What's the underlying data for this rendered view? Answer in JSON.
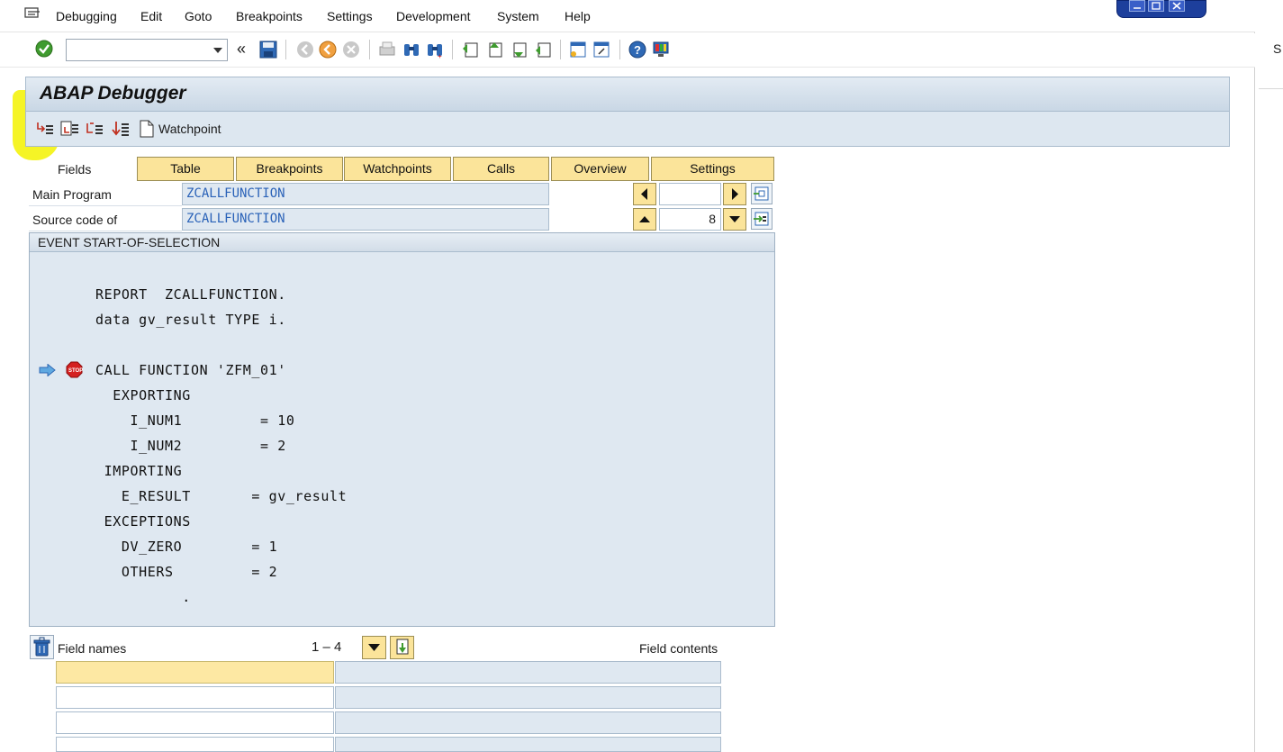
{
  "menu": {
    "items": [
      "Debugging",
      "Edit",
      "Goto",
      "Breakpoints",
      "Settings",
      "Development",
      "System",
      "Help"
    ]
  },
  "toolbar": {
    "command_value": "",
    "back_label": "«",
    "icons": [
      "check-icon",
      "save-icon",
      "back-icon",
      "exit-icon",
      "cancel-icon",
      "print-icon",
      "find-icon",
      "find-next-icon",
      "first-page-icon",
      "previous-page-icon",
      "next-page-icon",
      "last-page-icon",
      "new-session-icon",
      "shortcut-icon",
      "help-icon",
      "customize-layout-icon"
    ]
  },
  "debugger": {
    "title": "ABAP Debugger",
    "app_toolbar": {
      "watchpoint_label": "Watchpoint"
    },
    "tabs": {
      "fields_label": "Fields",
      "items": [
        "Table",
        "Breakpoints",
        "Watchpoints",
        "Calls",
        "Overview",
        "Settings"
      ]
    },
    "main_program": {
      "label": "Main Program",
      "value": "ZCALLFUNCTION",
      "nav_value": ""
    },
    "source_code": {
      "label": "Source code of",
      "value": "ZCALLFUNCTION",
      "line_value": "8"
    },
    "code": {
      "header": "EVENT START-OF-SELECTION",
      "lines": [
        "REPORT  ZCALLFUNCTION.",
        "data gv_result TYPE i.",
        "",
        "CALL FUNCTION 'ZFM_01'",
        "  EXPORTING",
        "    I_NUM1         = 10",
        "    I_NUM2         = 2",
        " IMPORTING",
        "   E_RESULT       = gv_result",
        " EXCEPTIONS",
        "   DV_ZERO        = 1",
        "   OTHERS         = 2",
        "          ."
      ]
    },
    "fields": {
      "names_label": "Field names",
      "range": "1 – 4",
      "contents_label": "Field contents"
    }
  },
  "side": {
    "letter": "S"
  }
}
